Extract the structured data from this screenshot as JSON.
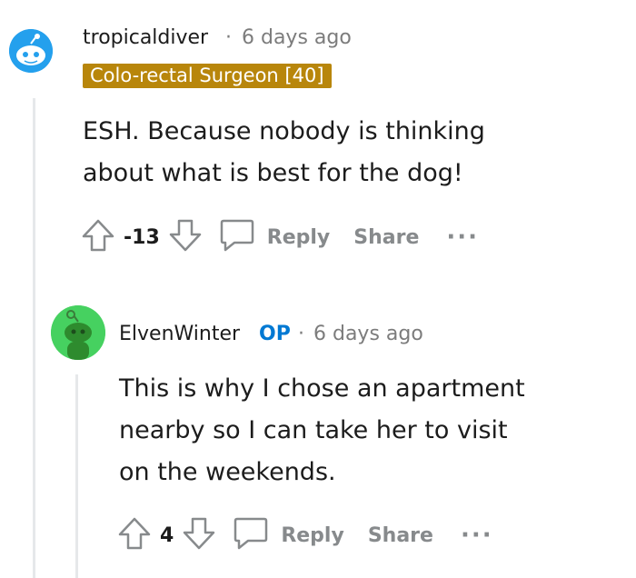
{
  "comments": [
    {
      "username": "tropicaldiver",
      "separator": "·",
      "time": "6 days ago",
      "flair": "Colo-rectal Surgeon [40]",
      "body": [
        "ESH. Because nobody is thinking",
        "about what is best for the dog!"
      ],
      "score": "-13",
      "reply_label": "Reply",
      "share_label": "Share",
      "more_label": "···"
    },
    {
      "username": "ElvenWinter",
      "op_badge": "OP",
      "separator": "·",
      "time": "6 days ago",
      "body": [
        "This is why I chose an apartment",
        "nearby so I can take her to visit",
        "on the weekends."
      ],
      "score": "4",
      "reply_label": "Reply",
      "share_label": "Share",
      "more_label": "···"
    }
  ],
  "colors": {
    "flair_bg": "#b8860b",
    "op_blue": "#0079d3",
    "avatar1_bg": "#24a0ed",
    "avatar2_bg": "#46d160",
    "meta_gray": "#7c7c7c",
    "action_gray": "#878a8c"
  },
  "icons": [
    "snoo-avatar-icon",
    "upvote-icon",
    "downvote-icon",
    "comment-bubble-icon",
    "more-dots-icon"
  ]
}
